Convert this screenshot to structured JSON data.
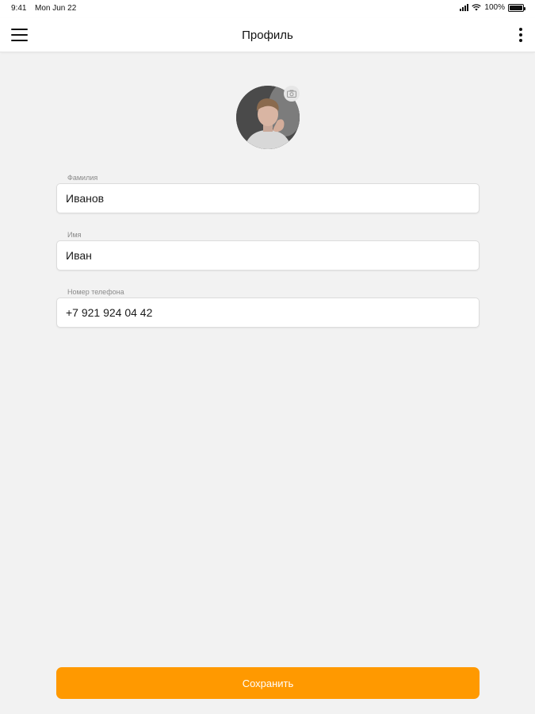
{
  "status_bar": {
    "time": "9:41",
    "date": "Mon Jun 22",
    "battery": "100%",
    "battery_level": 1.0
  },
  "nav": {
    "title": "Профиль",
    "menu_icon": "hamburger-menu-icon",
    "more_icon": "more-vertical-icon"
  },
  "profile": {
    "avatar": "user-photo",
    "camera_icon": "camera-icon"
  },
  "form": {
    "last_name": {
      "label": "Фамилия",
      "value": "Иванов"
    },
    "first_name": {
      "label": "Имя",
      "value": "Иван"
    },
    "phone": {
      "label": "Номер телефона",
      "value": "+7 921 924 04 42"
    }
  },
  "actions": {
    "save_label": "Сохранить"
  },
  "colors": {
    "accent": "#ff9900",
    "background": "#f2f2f2"
  }
}
